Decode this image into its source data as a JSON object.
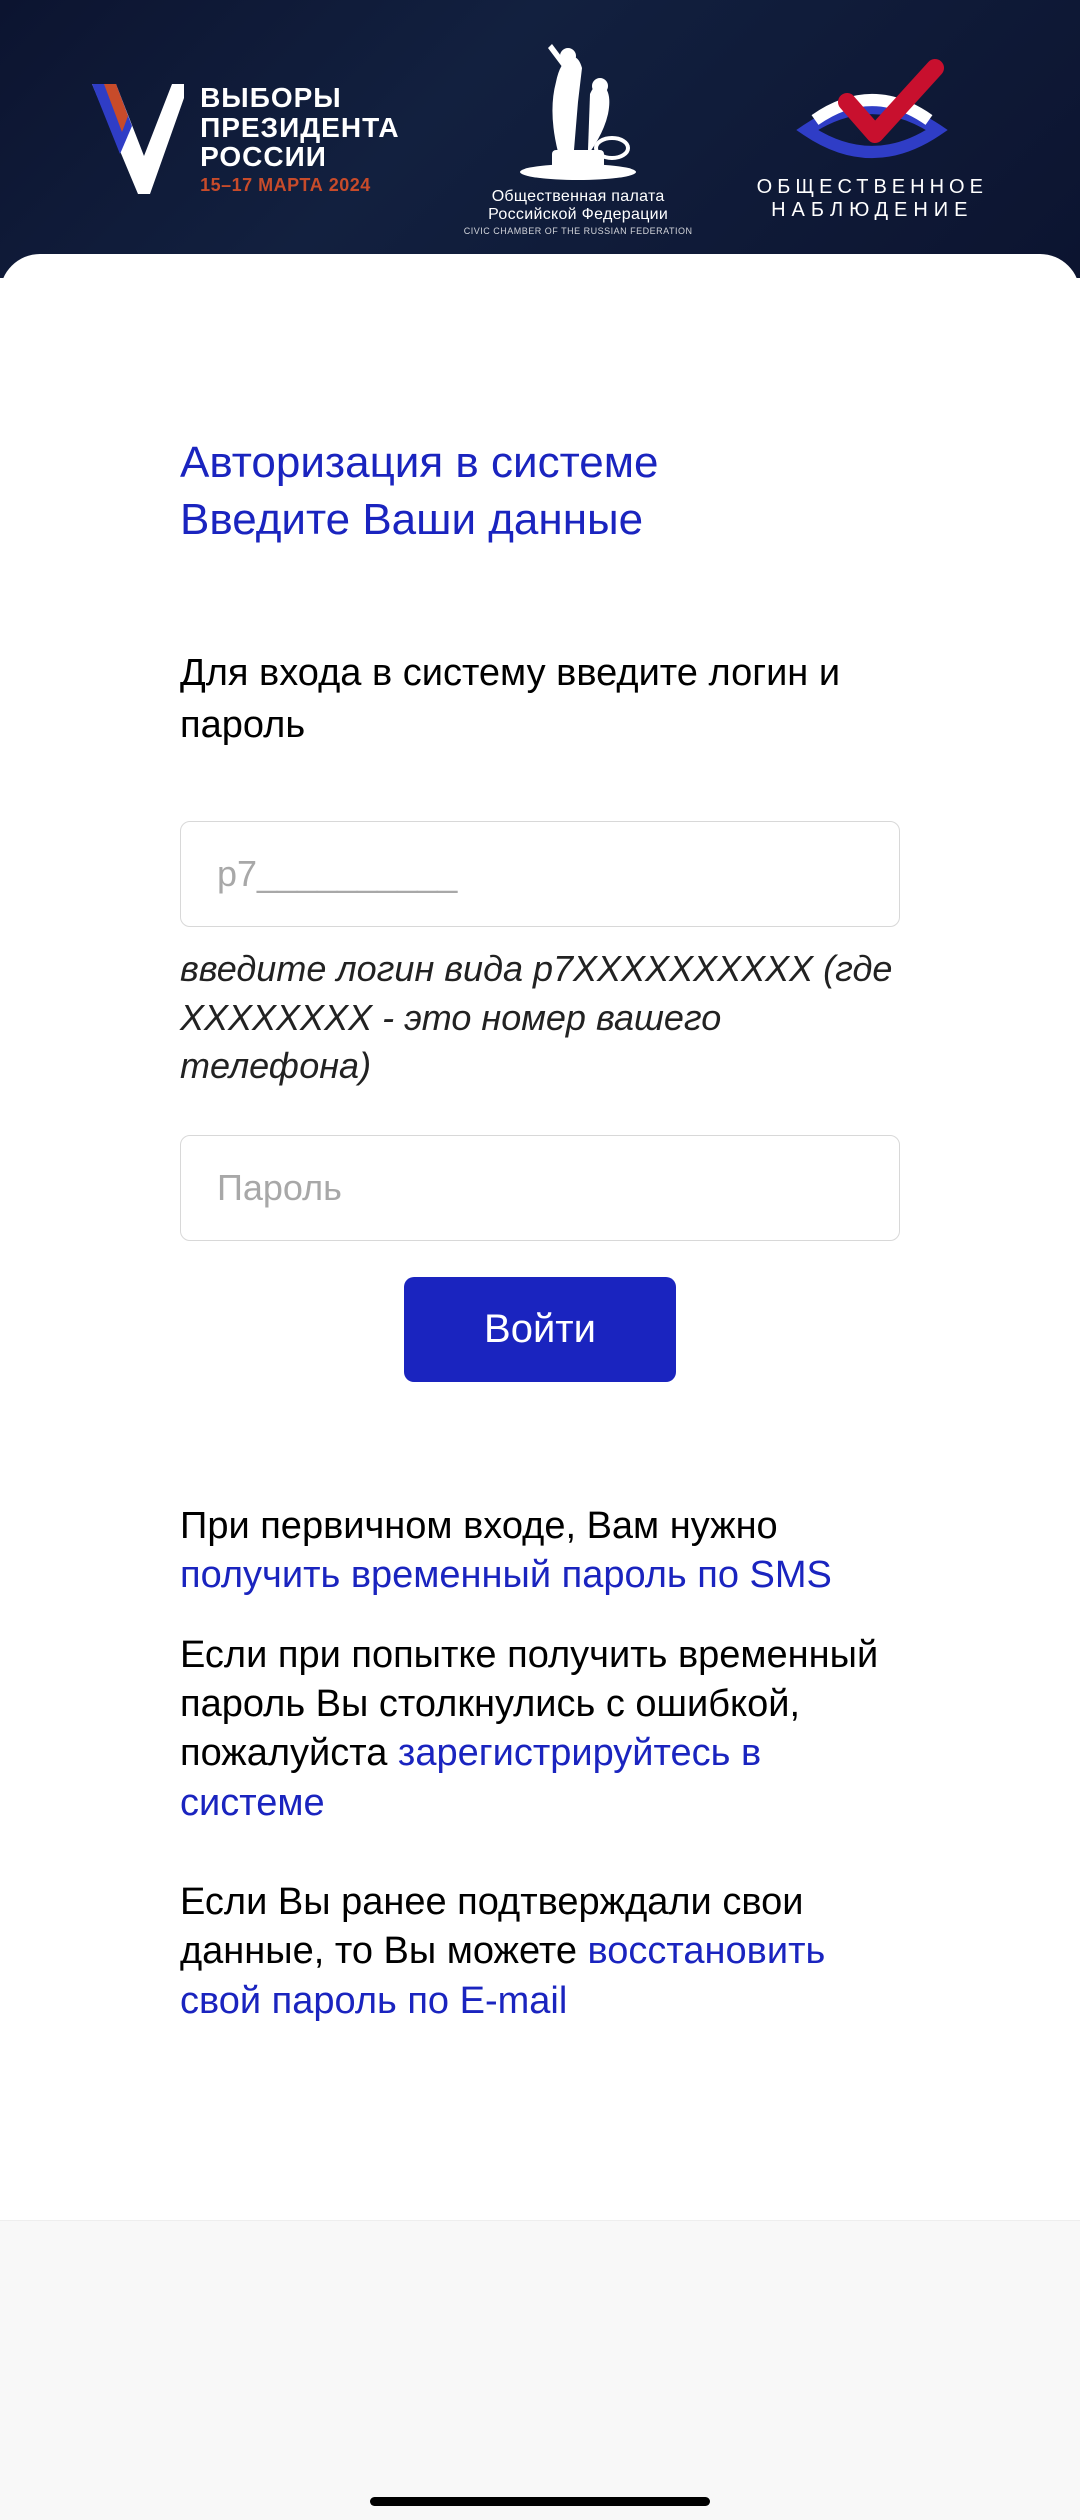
{
  "header": {
    "left": {
      "line1": "ВЫБОРЫ",
      "line2": "ПРЕЗИДЕНТА",
      "line3": "РОССИИ",
      "line4": "15–17 МАРТА 2024"
    },
    "center": {
      "line1": "Общественная палата",
      "line2": "Российской Федерации",
      "line3": "CIVIC CHAMBER OF THE RUSSIAN FEDERATION"
    },
    "right": {
      "line1": "ОБЩЕСТВЕННОЕ",
      "line2": "НАБЛЮДЕНИЕ"
    }
  },
  "form": {
    "title_line1": "Авторизация в системе",
    "title_line2": "Введите Ваши данные",
    "subtitle": "Для входа в систему введите логин и пароль",
    "login_placeholder": "p7__________",
    "login_hint": "введите логин вида p7XXXXXXXXXX (где XXXXXXXX - это номер вашего телефона)",
    "password_placeholder": "Пароль",
    "submit_label": "Войти"
  },
  "help": {
    "p1_text": "При первичном входе, Вам нужно ",
    "p1_link": "получить временный пароль по SMS",
    "p2_text": "Если при попытке получить временный пароль Вы столкнулись с ошибкой, пожалуйста ",
    "p2_link": "зарегистрируйтесь в системе",
    "p3_text": "Если Вы ранее подтверждали свои данные, то Вы можете ",
    "p3_link": "восстановить свой пароль по E-mail"
  }
}
